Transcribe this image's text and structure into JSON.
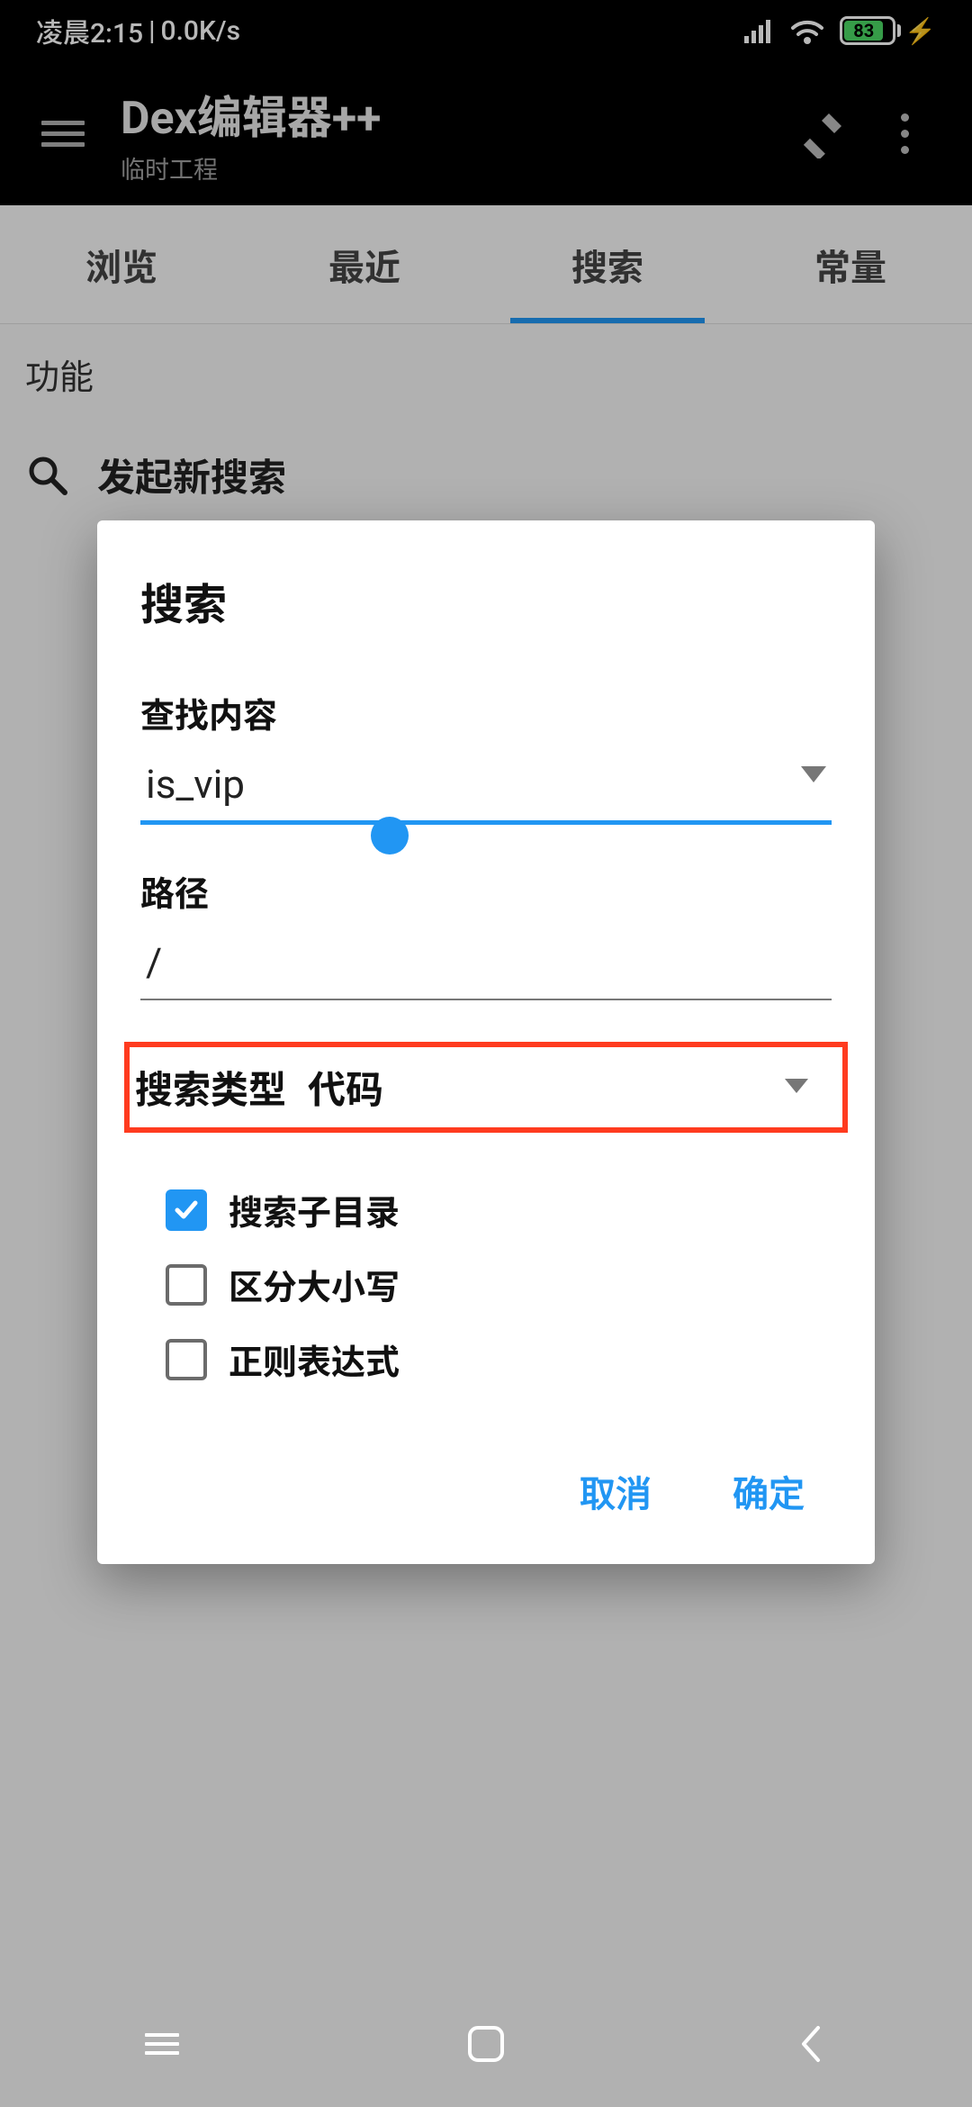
{
  "status": {
    "time_label": "凌晨2:15",
    "net_speed": "0.0K/s",
    "battery_pct": "83"
  },
  "header": {
    "title": "Dex编辑器++",
    "subtitle": "临时工程"
  },
  "tabs": [
    {
      "label": "浏览",
      "active": false
    },
    {
      "label": "最近",
      "active": false
    },
    {
      "label": "搜索",
      "active": true
    },
    {
      "label": "常量",
      "active": false
    }
  ],
  "section": {
    "heading": "功能",
    "new_search_label": "发起新搜索"
  },
  "dialog": {
    "title": "搜索",
    "find_label": "查找内容",
    "find_value": "is_vip",
    "path_label": "路径",
    "path_value": "/",
    "type_label": "搜索类型",
    "type_value": "代码",
    "options": {
      "sub_dirs": {
        "label": "搜索子目录",
        "checked": true
      },
      "case_sensitive": {
        "label": "区分大小写",
        "checked": false
      },
      "regex": {
        "label": "正则表达式",
        "checked": false
      }
    },
    "cancel": "取消",
    "ok": "确定"
  }
}
